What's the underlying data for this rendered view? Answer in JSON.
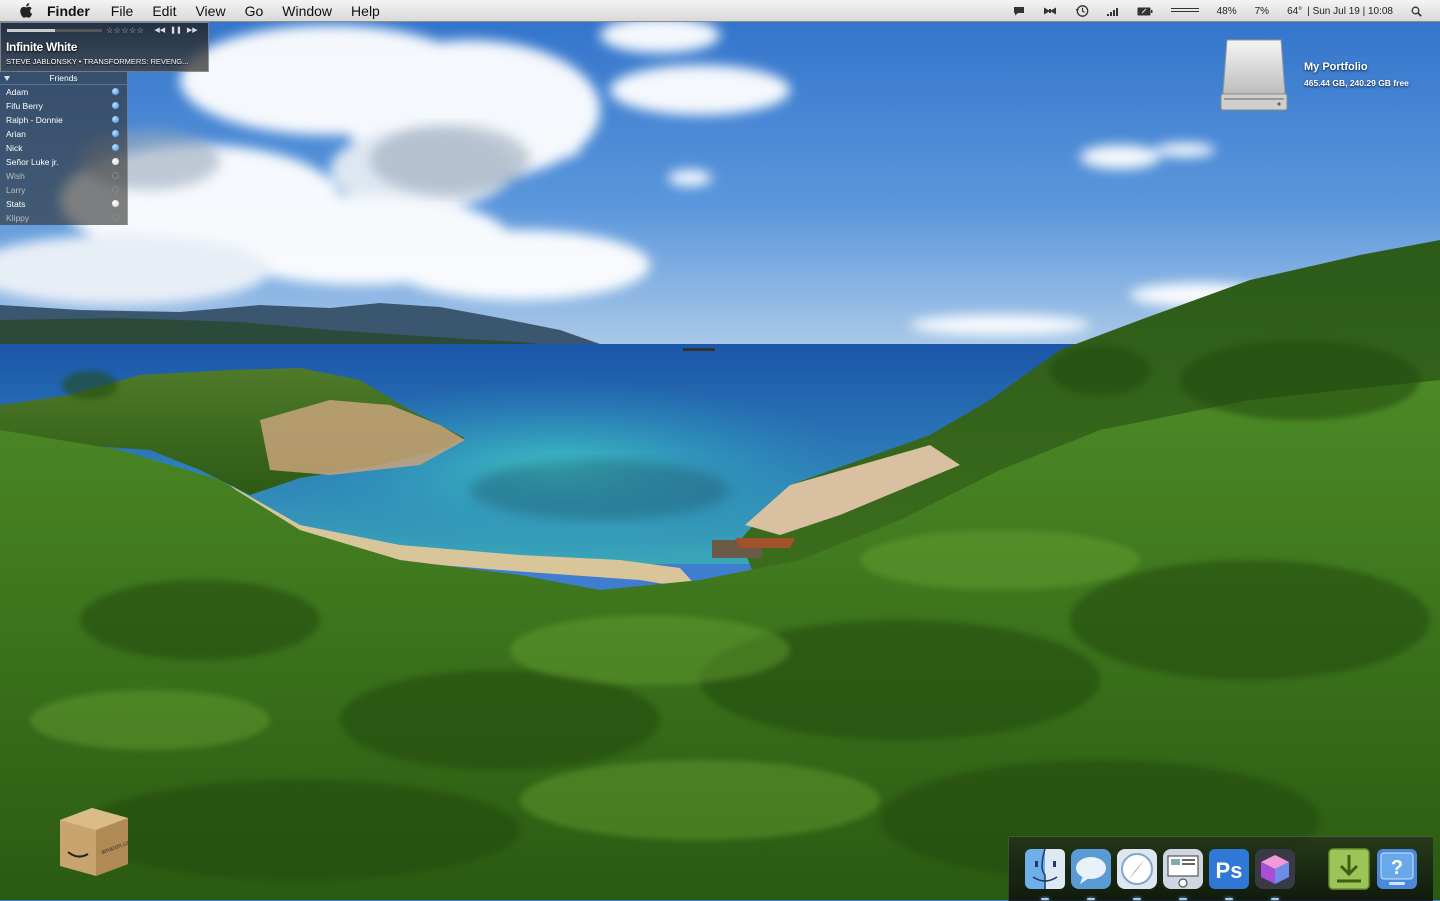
{
  "menubar": {
    "apple_icon": "apple-icon",
    "app_name": "Finder",
    "menus": [
      "File",
      "Edit",
      "View",
      "Go",
      "Window",
      "Help"
    ],
    "status_icons": [
      "chat-icon",
      "butterfly-icon",
      "time-machine-icon",
      "signal-bars-icon",
      "battery-icon",
      "volume-icon"
    ],
    "cpu": "48%",
    "memory": "7%",
    "temperature": "64°",
    "clock": "| Sun Jul 19 | 10:08",
    "spotlight_icon": "magnifier-icon"
  },
  "now_playing": {
    "rating": "☆☆☆☆☆",
    "progress": 0.5,
    "title": "Infinite White",
    "artist_album": "STEVE JABLONSKY • TRANSFORMERS: REVENG...",
    "controls": [
      "◀◀",
      "❚❚",
      "▶▶"
    ]
  },
  "friends": {
    "title": "Friends",
    "items": [
      {
        "name": "Adam",
        "status": "online"
      },
      {
        "name": "Fifu Berry",
        "status": "online"
      },
      {
        "name": "Ralph - Donnie",
        "status": "online"
      },
      {
        "name": "Arian",
        "status": "online"
      },
      {
        "name": "Nick",
        "status": "online"
      },
      {
        "name": "Señor Luke jr.",
        "status": "away"
      },
      {
        "name": "Wish",
        "status": "offline"
      },
      {
        "name": "Larry",
        "status": "offline"
      },
      {
        "name": "Stats",
        "status": "away"
      },
      {
        "name": "Klippy",
        "status": "offline"
      }
    ]
  },
  "desktop": {
    "drive_name": "My Portfolio",
    "drive_info": "465.44 GB, 240.29 GB free",
    "amazon_box_label": "amazon.ca"
  },
  "dock": {
    "items": [
      {
        "icon": "finder-icon",
        "running": true
      },
      {
        "icon": "adium-icon",
        "running": true
      },
      {
        "icon": "safari-icon",
        "running": true
      },
      {
        "icon": "preview-icon",
        "running": true
      },
      {
        "icon": "photoshop-icon",
        "label": "Ps",
        "running": true
      },
      {
        "icon": "cube-icon",
        "running": true
      },
      {
        "icon": "downloads-stack-icon",
        "running": false
      },
      {
        "icon": "help-icon",
        "label": "?",
        "running": false
      }
    ]
  }
}
